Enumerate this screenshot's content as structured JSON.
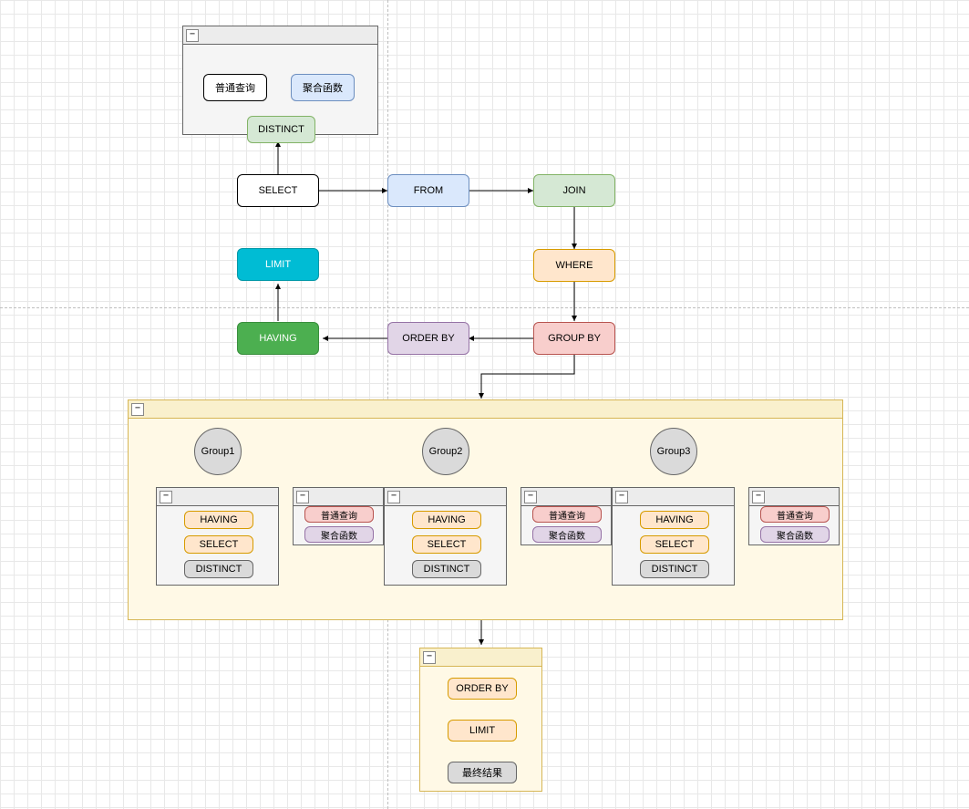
{
  "top_container": {
    "items": [
      "普通查询",
      "聚合函数",
      "DISTINCT"
    ]
  },
  "main_row": {
    "select": "SELECT",
    "from": "FROM",
    "join": "JOIN"
  },
  "where": "WHERE",
  "second_row": {
    "limit": "LIMIT",
    "having": "HAVING",
    "orderby": "ORDER BY",
    "groupby": "GROUP BY"
  },
  "big_container": {
    "groups": [
      {
        "title": "Group1",
        "left_box": [
          "HAVING",
          "SELECT",
          "DISTINCT"
        ],
        "right_box": [
          "普通查询",
          "聚合函数"
        ]
      },
      {
        "title": "Group2",
        "left_box": [
          "HAVING",
          "SELECT",
          "DISTINCT"
        ],
        "right_box": [
          "普通查询",
          "聚合函数"
        ]
      },
      {
        "title": "Group3",
        "left_box": [
          "HAVING",
          "SELECT",
          "DISTINCT"
        ],
        "right_box": [
          "普通查询",
          "聚合函数"
        ]
      }
    ]
  },
  "bottom_container": {
    "items": [
      "ORDER BY",
      "LIMIT",
      "最终结果"
    ]
  },
  "collapse_glyph": "−"
}
